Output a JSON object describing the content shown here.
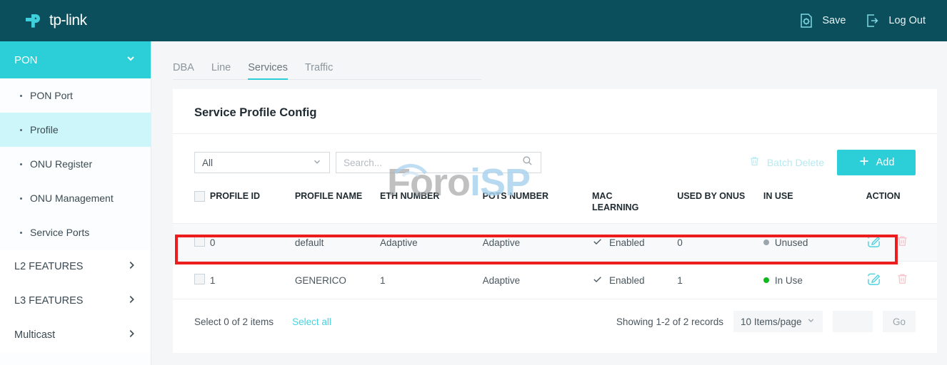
{
  "header": {
    "brand": "tp-link",
    "save_label": "Save",
    "logout_label": "Log Out",
    "background": "#0b4f5c"
  },
  "sidebar": {
    "group": {
      "label": "PON",
      "expanded": true,
      "color": "#2ccfd8"
    },
    "sub_items": [
      {
        "label": "PON Port",
        "active": false
      },
      {
        "label": "Profile",
        "active": true
      },
      {
        "label": "ONU Register",
        "active": false
      },
      {
        "label": "ONU Management",
        "active": false
      },
      {
        "label": "Service Ports",
        "active": false
      }
    ],
    "items": [
      {
        "label": "L2 FEATURES"
      },
      {
        "label": "L3 FEATURES"
      },
      {
        "label": "Multicast"
      }
    ]
  },
  "tabs": [
    {
      "label": "DBA",
      "active": false
    },
    {
      "label": "Line",
      "active": false
    },
    {
      "label": "Services",
      "active": true
    },
    {
      "label": "Traffic",
      "active": false
    }
  ],
  "card": {
    "title": "Service Profile Config"
  },
  "toolbar": {
    "filter_value": "All",
    "search_placeholder": "Search...",
    "search_value": "",
    "batch_delete_label": "Batch Delete",
    "add_label": "Add",
    "add_color": "#2ccfd8"
  },
  "watermark": {
    "text_primary": "Foro",
    "text_secondary": "iSP"
  },
  "table": {
    "columns": [
      "PROFILE ID",
      "PROFILE NAME",
      "ETH NUMBER",
      "POTS NUMBER",
      "MAC LEARNING",
      "USED BY ONUS",
      "IN USE",
      "ACTION"
    ],
    "mac_learning_line1": "MAC",
    "mac_learning_line2": "LEARNING",
    "rows": [
      {
        "profile_id": "0",
        "profile_name": "default",
        "eth_number": "Adaptive",
        "pots_number": "Adaptive",
        "mac_learning": "Enabled",
        "used_by_onus": "0",
        "in_use": "Unused",
        "in_use_color": "#9aa5ac",
        "checked": false,
        "highlighted": false
      },
      {
        "profile_id": "1",
        "profile_name": "GENERICO",
        "eth_number": "1",
        "pots_number": "Adaptive",
        "mac_learning": "Enabled",
        "used_by_onus": "1",
        "in_use": "In Use",
        "in_use_color": "#10b820",
        "checked": false,
        "highlighted": true
      }
    ]
  },
  "footer": {
    "selection_text": "Select 0 of 2 items",
    "select_all_label": "Select all",
    "records_text": "Showing 1-2 of 2 records",
    "per_page_value": "10 Items/page",
    "page_input_value": "",
    "go_label": "Go"
  },
  "annotation": {
    "color": "#ee1d1d"
  }
}
